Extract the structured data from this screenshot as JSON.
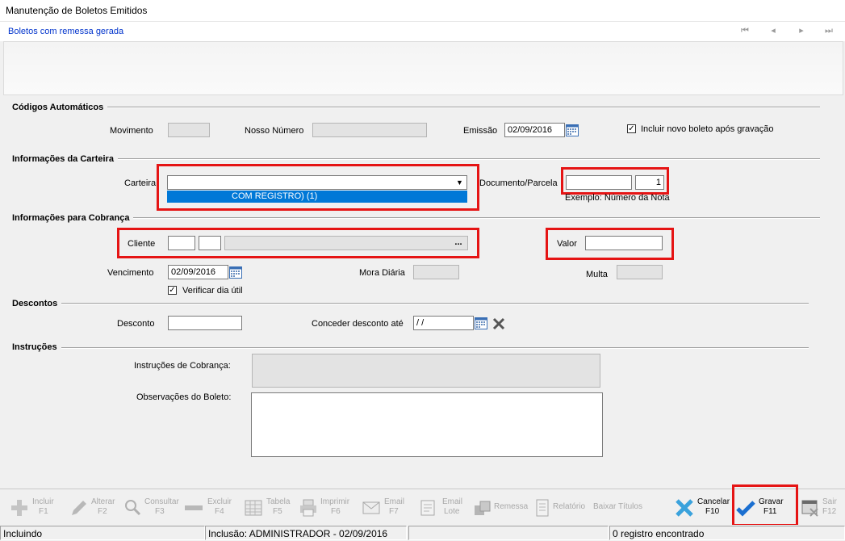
{
  "window": {
    "title": "Manutenção de Boletos Emitidos",
    "subtitle": "Boletos com remessa gerada"
  },
  "nav": [
    "first-icon",
    "prev-icon",
    "next-icon",
    "last-icon"
  ],
  "codigos": {
    "section": "Códigos Automáticos",
    "movimento_label": "Movimento",
    "movimento_value": "",
    "nosso_numero_label": "Nosso Número",
    "nosso_numero_value": "",
    "emissao_label": "Emissão",
    "emissao_value": "02/09/2016",
    "incluir_novo_label": "Incluir novo boleto após gravação",
    "incluir_novo_checked": true
  },
  "carteira": {
    "section": "Informações da Carteira",
    "carteira_label": "Carteira",
    "carteira_value": "",
    "dropdown_option": "COM REGISTRO)  (1)",
    "documento_label": "Documento/Parcela",
    "documento_value": "",
    "parcela_value": "1",
    "exemplo": "Exemplo: Número da Nota"
  },
  "cobranca": {
    "section": "Informações para Cobrança",
    "cliente_label": "Cliente",
    "cliente_ellipsis": "...",
    "valor_label": "Valor",
    "valor_value": "",
    "vencimento_label": "Vencimento",
    "vencimento_value": "02/09/2016",
    "mora_label": "Mora Diária",
    "multa_label": "Multa",
    "verificar_label": "Verificar dia útil",
    "verificar_checked": true
  },
  "descontos": {
    "section": "Descontos",
    "desconto_label": "Desconto",
    "desconto_value": "",
    "conceder_label": "Conceder desconto até",
    "conceder_value": " / /"
  },
  "instrucoes": {
    "section": "Instruções",
    "cobranca_label": "Instruções de Cobrança:",
    "observacoes_label": "Observações do Boleto:"
  },
  "toolbar": {
    "incluir": "Incluir",
    "incluir_key": "F1",
    "alterar": "Alterar",
    "alterar_key": "F2",
    "consultar": "Consultar",
    "consultar_key": "F3",
    "excluir": "Excluir",
    "excluir_key": "F4",
    "tabela": "Tabela",
    "tabela_key": "F5",
    "imprimir": "Imprimir",
    "imprimir_key": "F6",
    "email": "Email",
    "email_key": "F7",
    "email_lote": "Email",
    "email_lote_2": "Lote",
    "remessa": "Remessa",
    "relatorio": "Relatório",
    "baixar": "Baixar Títulos",
    "cancelar": "Cancelar",
    "cancelar_key": "F10",
    "gravar": "Gravar",
    "gravar_key": "F11",
    "sair": "Sair",
    "sair_key": "F12"
  },
  "status": {
    "mode": "Incluindo",
    "inclusao": "Inclusão: ADMINISTRADOR - 02/09/2016",
    "registros": "0 registro encontrado"
  },
  "colors": {
    "accent_blue": "#0078d7",
    "highlight_red": "#e51414",
    "link_blue": "#0033cc"
  }
}
